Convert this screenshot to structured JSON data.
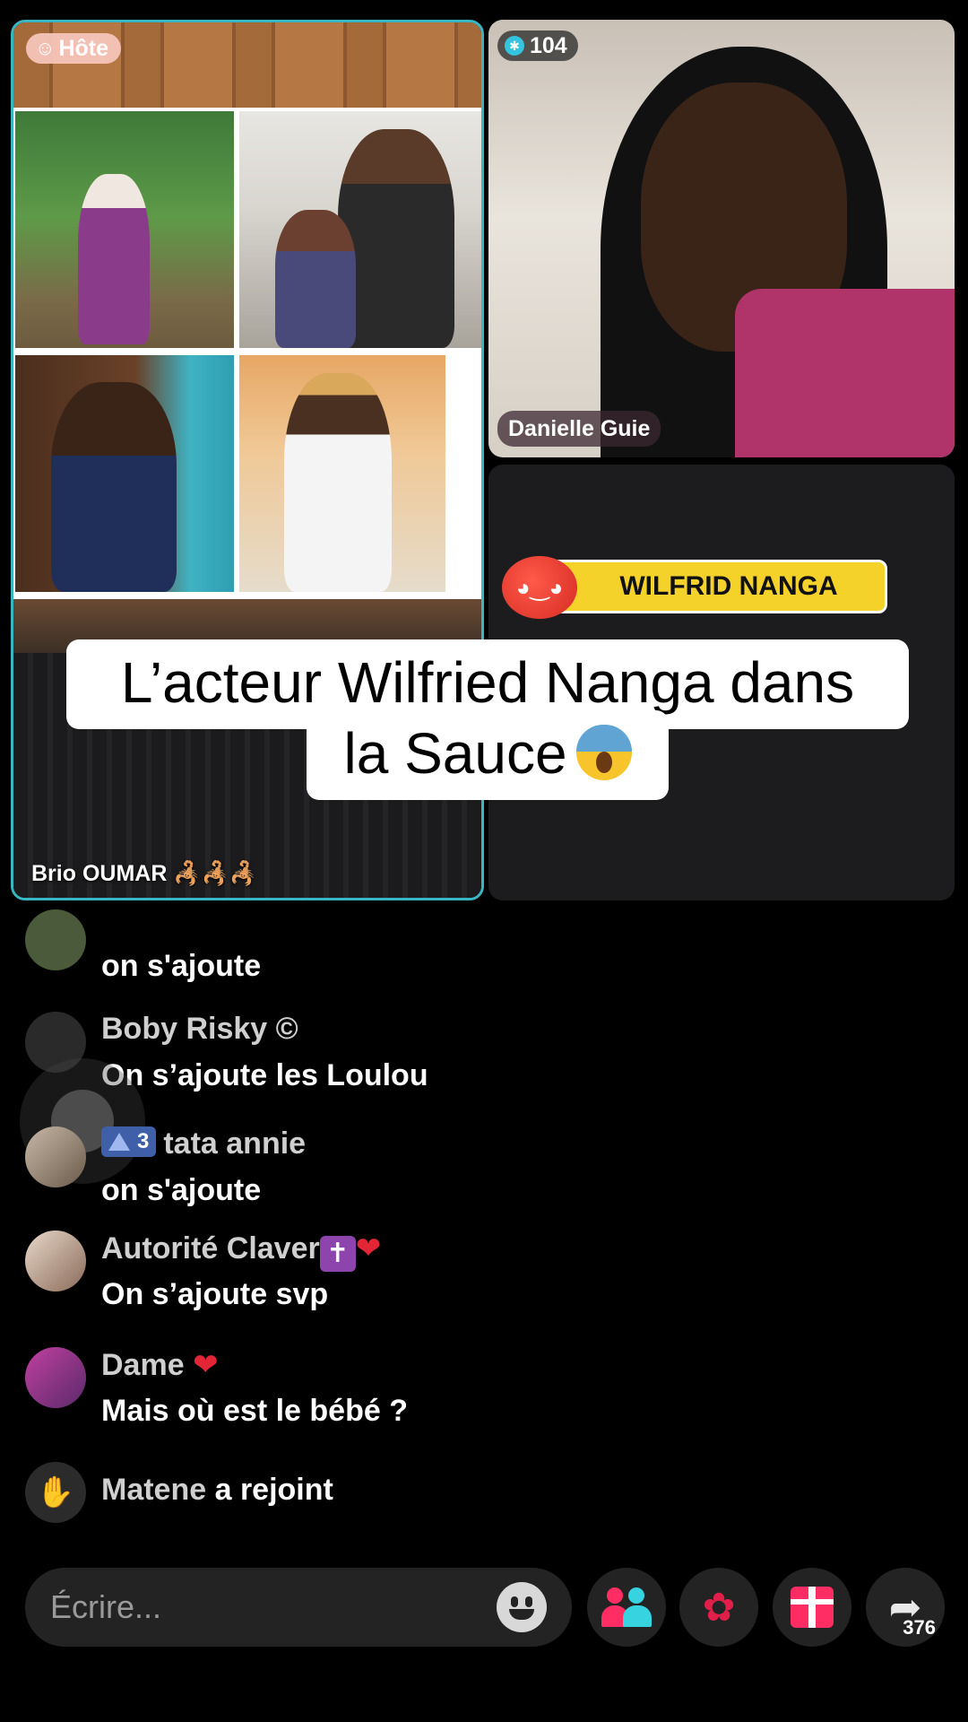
{
  "host_panel": {
    "badge": "Hôte",
    "badge_icon": "host-icon",
    "name": "Brio OUMAR 🦂🦂🦂"
  },
  "guest_panel": {
    "viewer_count": "104",
    "name": "Danielle Guie"
  },
  "banner": {
    "text": "WILFRID NANGA"
  },
  "caption": {
    "line1": "L’acteur Wilfried Nanga dans",
    "line2": "la Sauce"
  },
  "comments": [
    {
      "name": "",
      "text": "on s'ajoute"
    },
    {
      "name": "Boby Risky ©",
      "text": "On s’ajoute les Loulou"
    },
    {
      "level": "3",
      "name": "tata annie",
      "text": "on s'ajoute"
    },
    {
      "name": "Autorité Claver",
      "text": "On s’ajoute svp"
    },
    {
      "name": "Dame",
      "text": "Mais où est le bébé ?"
    }
  ],
  "join": {
    "name": "Matene",
    "action": "a rejoint"
  },
  "bottom_bar": {
    "input_placeholder": "Écrire...",
    "share_count": "376"
  },
  "colors": {
    "host_border": "#38b6c2",
    "banner_yellow": "#f4d22a",
    "gift_pink": "#ff2d63"
  }
}
